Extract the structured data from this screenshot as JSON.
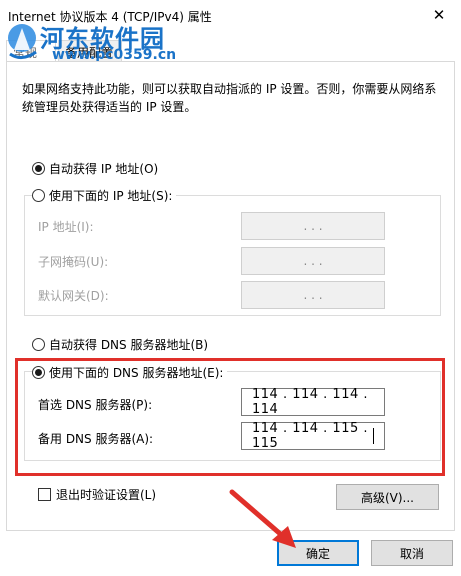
{
  "window": {
    "title": "Internet 协议版本 4 (TCP/IPv4) 属性",
    "close_glyph": "✕"
  },
  "watermark": {
    "text": "河东软件园",
    "url": "www.pc0359.cn"
  },
  "tabs": [
    {
      "label": "常规"
    },
    {
      "label": "备用配置"
    }
  ],
  "description": "如果网络支持此功能，则可以获取自动指派的 IP 设置。否则，你需要从网络系统管理员处获得适当的 IP 设置。",
  "ip": {
    "auto_label": "自动获得 IP 地址(O)",
    "manual_label": "使用下面的 IP 地址(S):",
    "selected": "auto",
    "fields": [
      {
        "label": "IP 地址(I):",
        "value": ".   .   ."
      },
      {
        "label": "子网掩码(U):",
        "value": ".   .   ."
      },
      {
        "label": "默认网关(D):",
        "value": ".   .   ."
      }
    ]
  },
  "dns": {
    "auto_label": "自动获得 DNS 服务器地址(B)",
    "manual_label": "使用下面的 DNS 服务器地址(E):",
    "selected": "manual",
    "preferred_label": "首选 DNS 服务器(P):",
    "preferred_value": "114 . 114 . 114 . 114",
    "alternate_label": "备用 DNS 服务器(A):",
    "alternate_value": "114 . 114 . 115 . 115"
  },
  "validate_label": "退出时验证设置(L)",
  "buttons": {
    "advanced": "高级(V)...",
    "ok": "确定",
    "cancel": "取消"
  },
  "colors": {
    "highlight": "#e0302a",
    "accent": "#0078d7",
    "watermark": "#1a73c8"
  }
}
